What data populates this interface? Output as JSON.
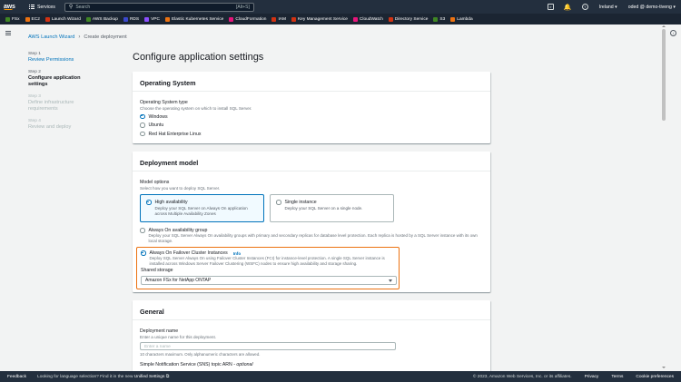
{
  "topnav": {
    "logo": "aws",
    "services_label": "Services",
    "search_placeholder": "Search",
    "search_shortcut": "[Alt+S]",
    "region": "Ireland",
    "account": "oded @ demo-tiveng"
  },
  "favorites": [
    {
      "label": "FSx",
      "color": "#3f8624"
    },
    {
      "label": "EC2",
      "color": "#ec7211"
    },
    {
      "label": "Launch Wizard",
      "color": "#d13212"
    },
    {
      "label": "AWS Backup",
      "color": "#3f8624"
    },
    {
      "label": "RDS",
      "color": "#3b48cc"
    },
    {
      "label": "VPC",
      "color": "#8c4fff"
    },
    {
      "label": "Elastic Kubernetes Service",
      "color": "#ec7211"
    },
    {
      "label": "CloudFormation",
      "color": "#e7157b"
    },
    {
      "label": "IAM",
      "color": "#d13212"
    },
    {
      "label": "Key Management Service",
      "color": "#d13212"
    },
    {
      "label": "CloudWatch",
      "color": "#e7157b"
    },
    {
      "label": "Directory Service",
      "color": "#d13212"
    },
    {
      "label": "S3",
      "color": "#3f8624"
    },
    {
      "label": "Lambda",
      "color": "#ec7211"
    }
  ],
  "breadcrumb": {
    "root": "AWS Launch Wizard",
    "current": "Create deployment"
  },
  "steps": [
    {
      "num": "Step 1",
      "title": "Review Permissions"
    },
    {
      "num": "Step 2",
      "title": "Configure application settings"
    },
    {
      "num": "Step 3",
      "title": "Define infrastructure requirements"
    },
    {
      "num": "Step 4",
      "title": "Review and deploy"
    }
  ],
  "page_title": "Configure application settings",
  "os_panel": {
    "heading": "Operating System",
    "field_label": "Operating System type",
    "field_desc": "Choose the operating system on which to install SQL Server.",
    "options": [
      "Windows",
      "Ubuntu",
      "Red Hat Enterprise Linux"
    ],
    "selected": "Windows"
  },
  "deploy_panel": {
    "heading": "Deployment model",
    "field_label": "Model options",
    "field_desc": "Select how you want to deploy SQL Server.",
    "tiles": [
      {
        "title": "High availability",
        "desc": "Deploy your SQL Server on Always On application across Multiple Availability Zones"
      },
      {
        "title": "Single instance",
        "desc": "Deploy your SQL Server on a single node."
      }
    ],
    "ag_title": "Always On availability group",
    "ag_desc": "Deploy your SQL Server Always On availability groups with primary and secondary replicas for database level protection. Each replica is hosted by a SQL Server instance with its own local storage.",
    "fci_title": "Always On Failover Cluster Instances",
    "fci_info": "Info",
    "fci_desc": "Deploy SQL Server Always On using Failover Cluster Instances (FCI) for instance-level protection. A single SQL Server instance is installed across Windows Server Failover Clustering (WSFC) nodes to ensure high availability and storage sharing.",
    "storage_label": "Shared storage",
    "storage_value": "Amazon FSx for NetApp ONTAP"
  },
  "general_panel": {
    "heading": "General",
    "name_label": "Deployment name",
    "name_desc": "Enter a unique name for this deployment.",
    "name_placeholder": "Enter a name",
    "name_hint": "10 characters maximum. Only alphanumeric characters are allowed.",
    "sns_label": "Simple Notification Service (SNS) topic ARN",
    "sns_optional": " - optional"
  },
  "footer": {
    "feedback": "Feedback",
    "lang_text": "Looking for language selection? Find it in the new",
    "lang_link": "Unified Settings",
    "copyright": "© 2023, Amazon Web Services, Inc. or its affiliates.",
    "privacy": "Privacy",
    "terms": "Terms",
    "cookies": "Cookie preferences"
  }
}
